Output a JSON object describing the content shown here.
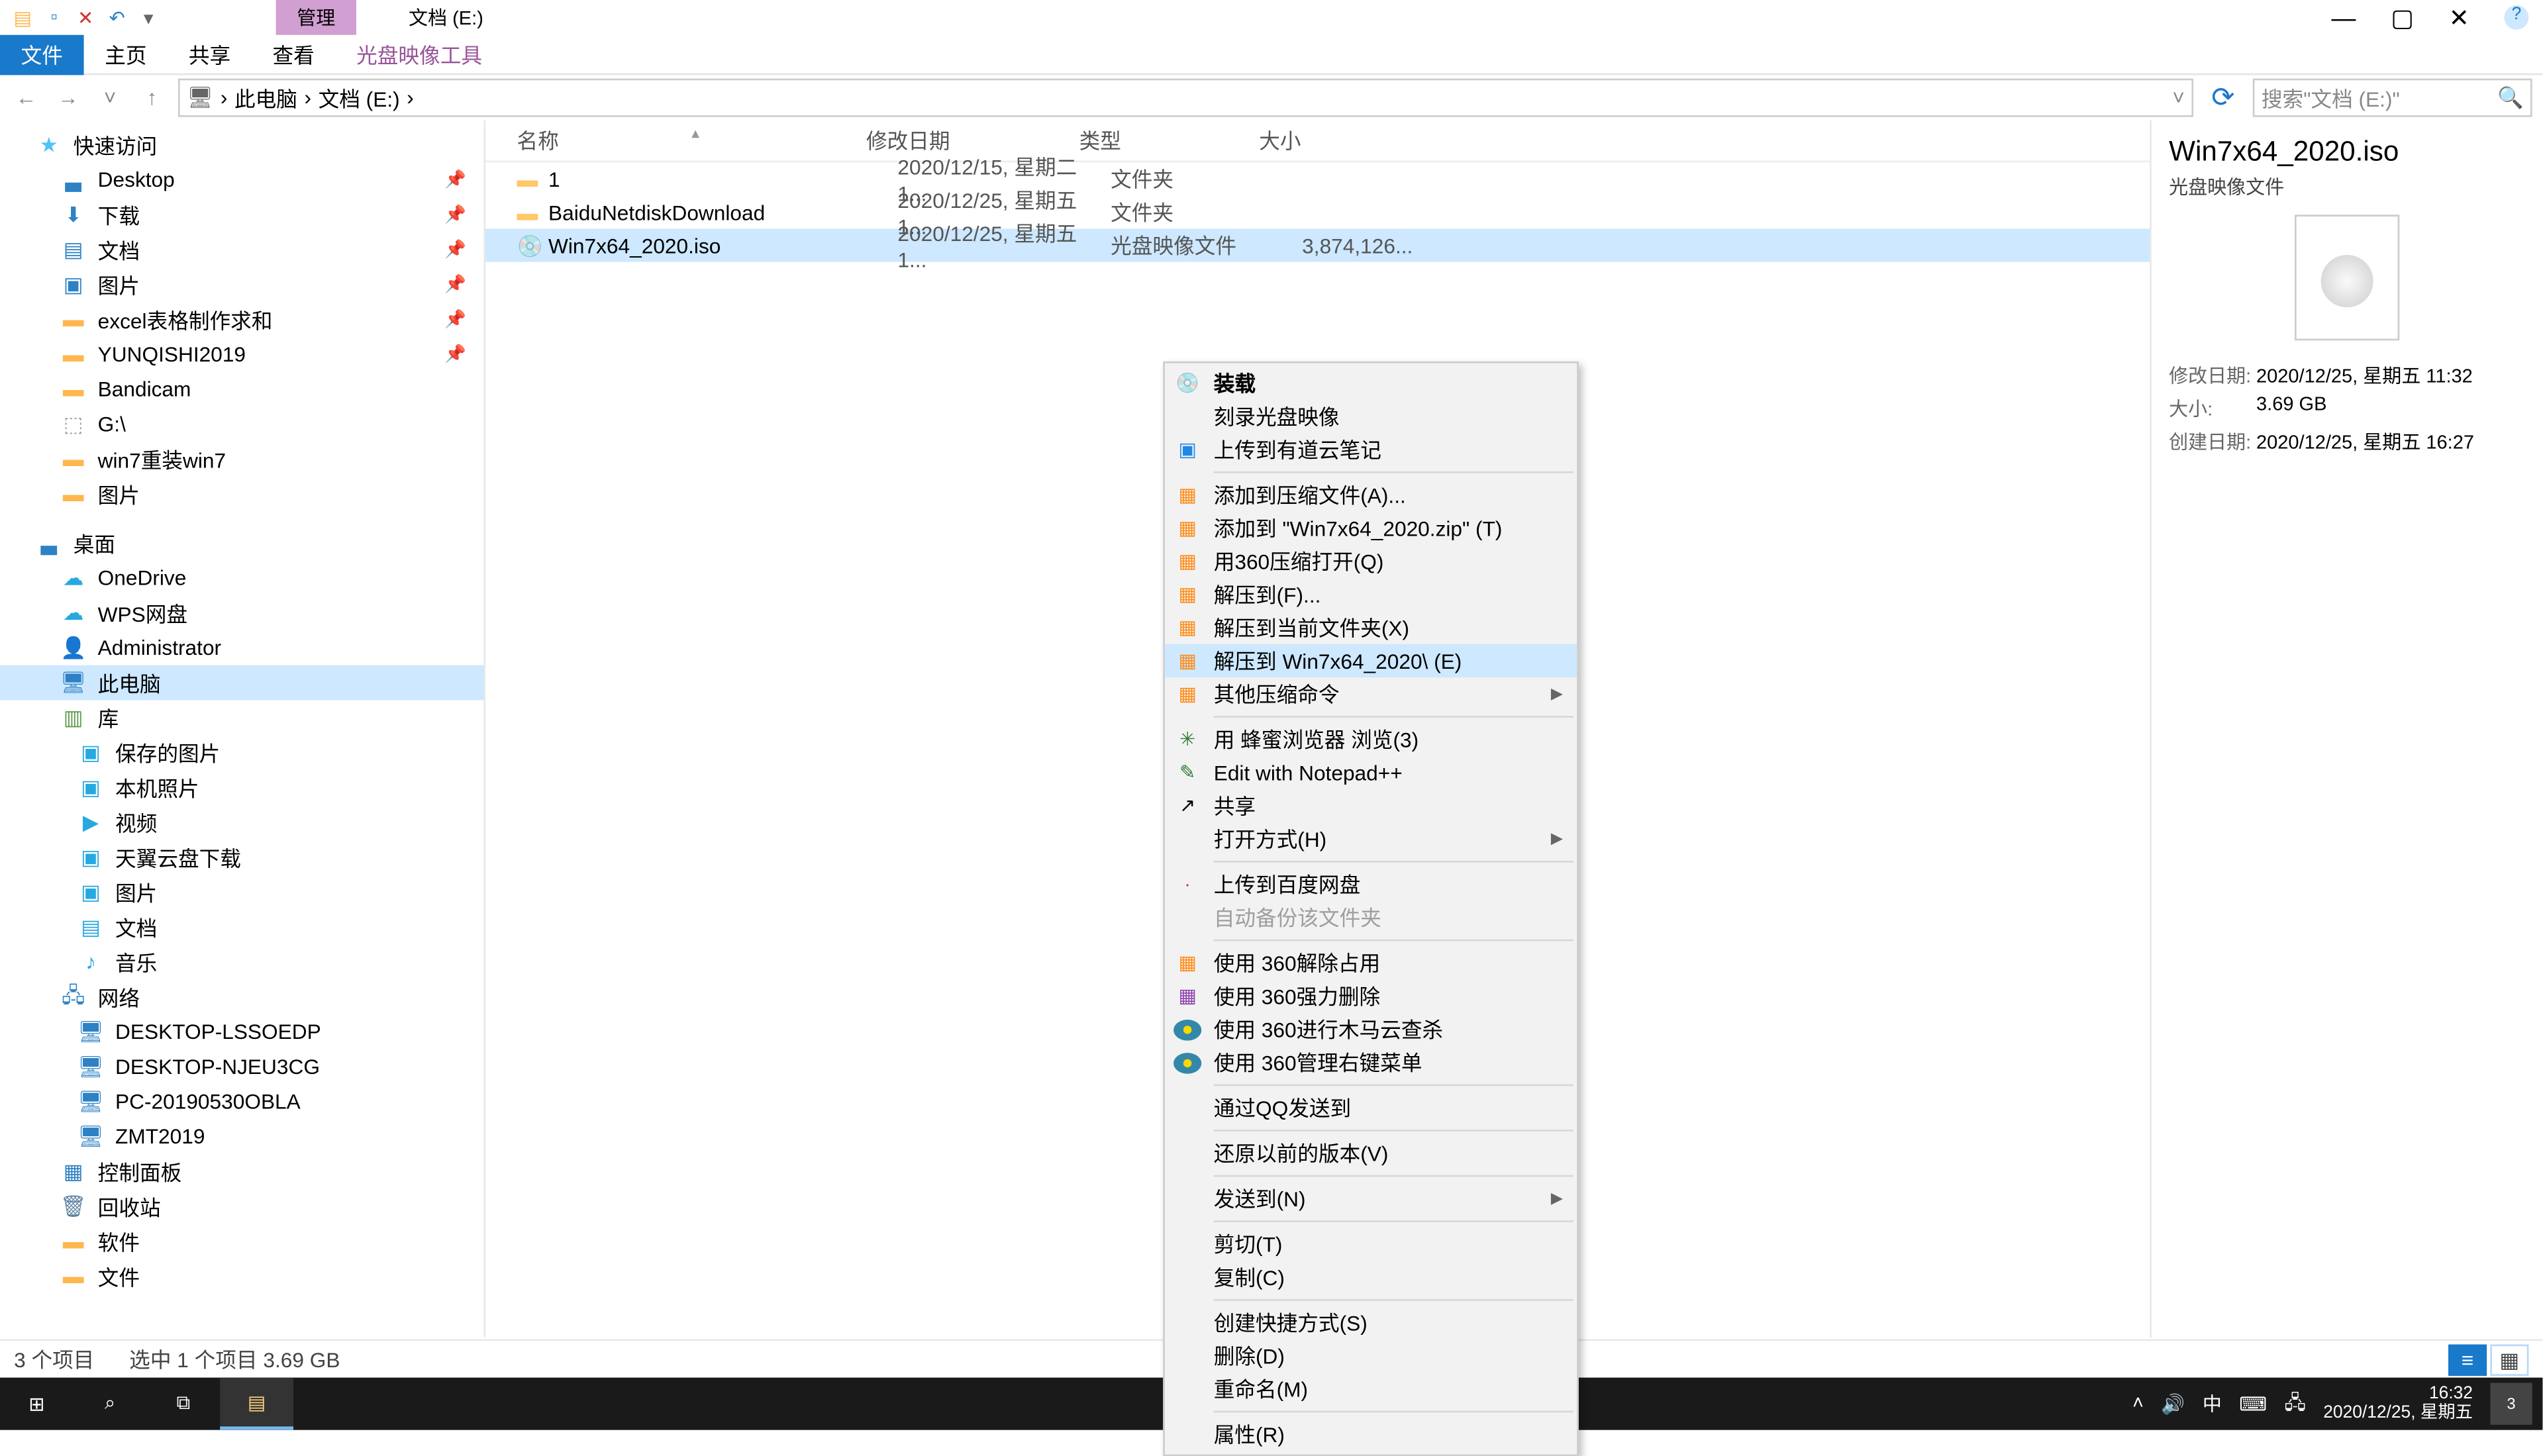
{
  "titlebar": {
    "manage": "管理",
    "title": "文档 (E:)"
  },
  "win": {
    "min": "—",
    "max": "▢",
    "close": "✕",
    "help": "?"
  },
  "ribbon": {
    "file": "文件",
    "home": "主页",
    "share": "共享",
    "view": "查看",
    "ctx": "光盘映像工具"
  },
  "nav": {
    "back": "←",
    "fwd": "→",
    "up": "↑"
  },
  "breadcrumb": {
    "pc": "此电脑",
    "e": "文档 (E:)",
    "sep": "›",
    "drop": "˅"
  },
  "search": {
    "placeholder": "搜索\"文档 (E:)\"",
    "icon": "🔍"
  },
  "tree": {
    "quick": "快速访问",
    "desktop": "Desktop",
    "download": "下载",
    "docs": "文档",
    "pics": "图片",
    "excel": "excel表格制作求和",
    "yun": "YUNQISHI2019",
    "bandicam": "Bandicam",
    "g": "G:\\",
    "win7": "win7重装win7",
    "pics2": "图片",
    "desktop2": "桌面",
    "onedrive": "OneDrive",
    "wps": "WPS网盘",
    "admin": "Administrator",
    "thispc": "此电脑",
    "lib": "库",
    "saved": "保存的图片",
    "local": "本机照片",
    "video": "视频",
    "tianyi": "天翼云盘下载",
    "pics3": "图片",
    "docs2": "文档",
    "music": "音乐",
    "network": "网络",
    "n1": "DESKTOP-LSSOEDP",
    "n2": "DESKTOP-NJEU3CG",
    "n3": "PC-20190530OBLA",
    "n4": "ZMT2019",
    "cpanel": "控制面板",
    "recycle": "回收站",
    "soft": "软件",
    "files": "文件"
  },
  "cols": {
    "name": "名称",
    "date": "修改日期",
    "type": "类型",
    "size": "大小"
  },
  "rows": [
    {
      "icon": "folder",
      "name": "1",
      "date": "2020/12/15, 星期二 1...",
      "type": "文件夹",
      "size": ""
    },
    {
      "icon": "folder",
      "name": "BaiduNetdiskDownload",
      "date": "2020/12/25, 星期五 1...",
      "type": "文件夹",
      "size": ""
    },
    {
      "icon": "iso",
      "name": "Win7x64_2020.iso",
      "date": "2020/12/25, 星期五 1...",
      "type": "光盘映像文件",
      "size": "3,874,126..."
    }
  ],
  "menu": [
    {
      "icon": "💿",
      "cls": "",
      "label": "装载",
      "bold": true
    },
    {
      "icon": "",
      "cls": "",
      "label": "刻录光盘映像"
    },
    {
      "icon": "▣",
      "cls": "c-blue",
      "label": "上传到有道云笔记"
    },
    {
      "sep": true
    },
    {
      "icon": "▦",
      "cls": "c-orange",
      "label": "添加到压缩文件(A)..."
    },
    {
      "icon": "▦",
      "cls": "c-orange",
      "label": "添加到 \"Win7x64_2020.zip\" (T)"
    },
    {
      "icon": "▦",
      "cls": "c-orange",
      "label": "用360压缩打开(Q)"
    },
    {
      "icon": "▦",
      "cls": "c-orange",
      "label": "解压到(F)..."
    },
    {
      "icon": "▦",
      "cls": "c-orange",
      "label": "解压到当前文件夹(X)"
    },
    {
      "icon": "▦",
      "cls": "c-orange",
      "label": "解压到 Win7x64_2020\\ (E)",
      "hov": true
    },
    {
      "icon": "▦",
      "cls": "c-orange",
      "label": "其他压缩命令",
      "sub": true
    },
    {
      "sep": true
    },
    {
      "icon": "✳",
      "cls": "c-green",
      "label": "用 蜂蜜浏览器 浏览(3)"
    },
    {
      "icon": "✎",
      "cls": "c-green",
      "label": "Edit with Notepad++"
    },
    {
      "icon": "↗",
      "cls": "",
      "label": "共享"
    },
    {
      "icon": "",
      "cls": "",
      "label": "打开方式(H)",
      "sub": true
    },
    {
      "sep": true
    },
    {
      "icon": "·",
      "cls": "c-red",
      "label": "上传到百度网盘"
    },
    {
      "icon": "",
      "cls": "",
      "label": "自动备份该文件夹",
      "dis": true
    },
    {
      "sep": true
    },
    {
      "icon": "▦",
      "cls": "c-orange",
      "label": "使用 360解除占用"
    },
    {
      "icon": "▦",
      "cls": "c-purple",
      "label": "使用 360强力删除"
    },
    {
      "icon": "●",
      "cls": "c-yellow",
      "label": "使用 360进行木马云查杀"
    },
    {
      "icon": "●",
      "cls": "c-yellow",
      "label": "使用 360管理右键菜单"
    },
    {
      "sep": true
    },
    {
      "icon": "",
      "cls": "",
      "label": "通过QQ发送到"
    },
    {
      "sep": true
    },
    {
      "icon": "",
      "cls": "",
      "label": "还原以前的版本(V)"
    },
    {
      "sep": true
    },
    {
      "icon": "",
      "cls": "",
      "label": "发送到(N)",
      "sub": true
    },
    {
      "sep": true
    },
    {
      "icon": "",
      "cls": "",
      "label": "剪切(T)"
    },
    {
      "icon": "",
      "cls": "",
      "label": "复制(C)"
    },
    {
      "sep": true
    },
    {
      "icon": "",
      "cls": "",
      "label": "创建快捷方式(S)"
    },
    {
      "icon": "",
      "cls": "",
      "label": "删除(D)"
    },
    {
      "icon": "",
      "cls": "",
      "label": "重命名(M)"
    },
    {
      "sep": true
    },
    {
      "icon": "",
      "cls": "",
      "label": "属性(R)"
    }
  ],
  "preview": {
    "title": "Win7x64_2020.iso",
    "type": "光盘映像文件",
    "dmlabel": "修改日期:",
    "dm": "2020/12/25, 星期五 11:32",
    "szlabel": "大小:",
    "sz": "3.69 GB",
    "dclabel": "创建日期:",
    "dc": "2020/12/25, 星期五 16:27"
  },
  "status": {
    "count": "3 个项目",
    "sel": "选中 1 个项目  3.69 GB"
  },
  "taskbar": {
    "ime": "中",
    "time": "16:32",
    "date": "2020/12/25, 星期五",
    "notif": "3"
  }
}
